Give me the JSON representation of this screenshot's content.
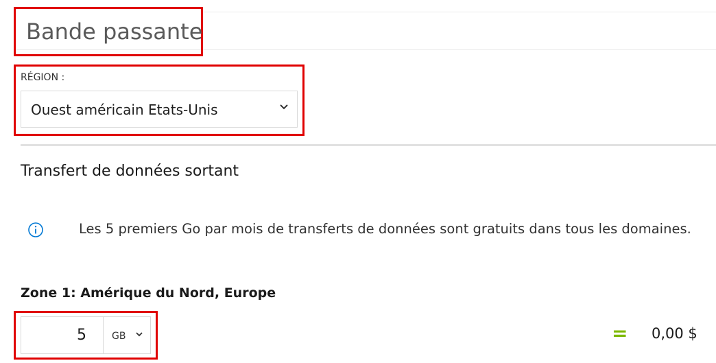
{
  "header": {
    "title": "Bande passante"
  },
  "region": {
    "label": "RÉGION :",
    "selected": "Ouest américain Etats-Unis",
    "chevron_icon": "chevron-down-icon"
  },
  "transfer": {
    "heading": "Transfert de données sortant",
    "info_icon": "info-icon",
    "info_text": "Les 5 premiers Go par mois de transferts de données sont gratuits dans tous les domaines."
  },
  "zone": {
    "heading": "Zone 1: Amérique du Nord, Europe",
    "quantity": "5",
    "unit": "GB",
    "equals_sign": "=",
    "cost": "0,00 $"
  },
  "colors": {
    "highlight": "#e00000",
    "accent_info": "#0078d4",
    "equals_green": "#7fba00"
  }
}
